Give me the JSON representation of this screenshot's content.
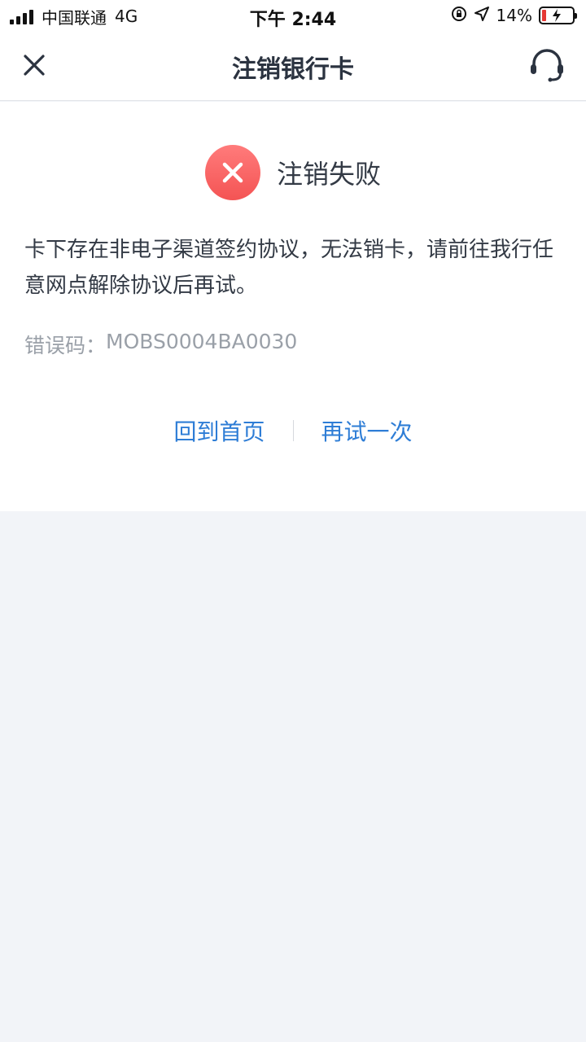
{
  "status_bar": {
    "carrier": "中国联通",
    "network": "4G",
    "time": "下午 2:44",
    "battery_percent": "14%",
    "battery_level": 0.14
  },
  "nav": {
    "title": "注销银行卡",
    "close_icon": "close-icon",
    "service_icon": "headset-icon"
  },
  "result": {
    "title": "注销失败",
    "message": "卡下存在非电子渠道签约协议，无法销卡，请前往我行任意网点解除协议后再试。",
    "error_code_label": "错误码：",
    "error_code": "MOBS0004BA0030",
    "icon": "error-x-icon",
    "icon_color": "#f45454"
  },
  "actions": {
    "home_label": "回到首页",
    "retry_label": "再试一次",
    "link_color": "#2e7dd6"
  }
}
